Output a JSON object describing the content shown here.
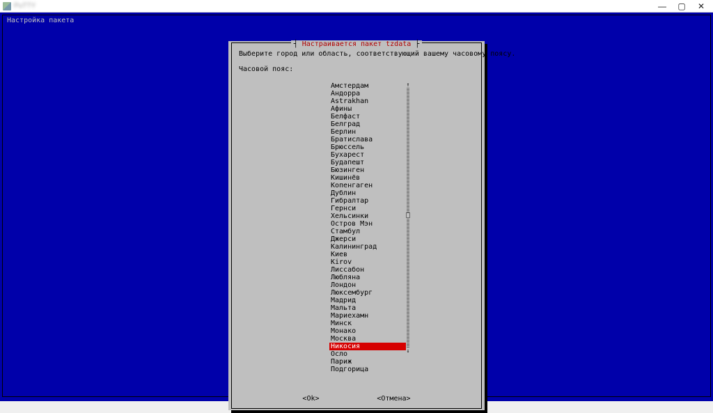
{
  "window": {
    "title": "PuTTY",
    "buttons": {
      "min": "—",
      "max": "▢",
      "close": "✕"
    }
  },
  "terminal": {
    "header": "Настройка пакета"
  },
  "dialog": {
    "title": "Настраивается пакет tzdata",
    "prompt": "Выберите город или область, соответствующий вашему часовому поясу.",
    "label": "Часовой пояс:",
    "ok": "<Ok>",
    "cancel": "<Отмена>",
    "selected_index": 34,
    "cities": [
      "Амстердам",
      "Андорра",
      "Astrakhan",
      "Афины",
      "Белфаст",
      "Белград",
      "Берлин",
      "Братислава",
      "Брюссель",
      "Бухарест",
      "Будапешт",
      "Бюзинген",
      "Кишинёв",
      "Копенгаген",
      "Дублин",
      "Гибралтар",
      "Гернси",
      "Хельсинки",
      "Остров Мэн",
      "Стамбул",
      "Джерси",
      "Калининград",
      "Киев",
      "Kirov",
      "Лиссабон",
      "Любляна",
      "Лондон",
      "Люксембург",
      "Мадрид",
      "Мальта",
      "Мариехамн",
      "Минск",
      "Монако",
      "Москва",
      "Никосия",
      "Осло",
      "Париж",
      "Подгорица"
    ]
  }
}
